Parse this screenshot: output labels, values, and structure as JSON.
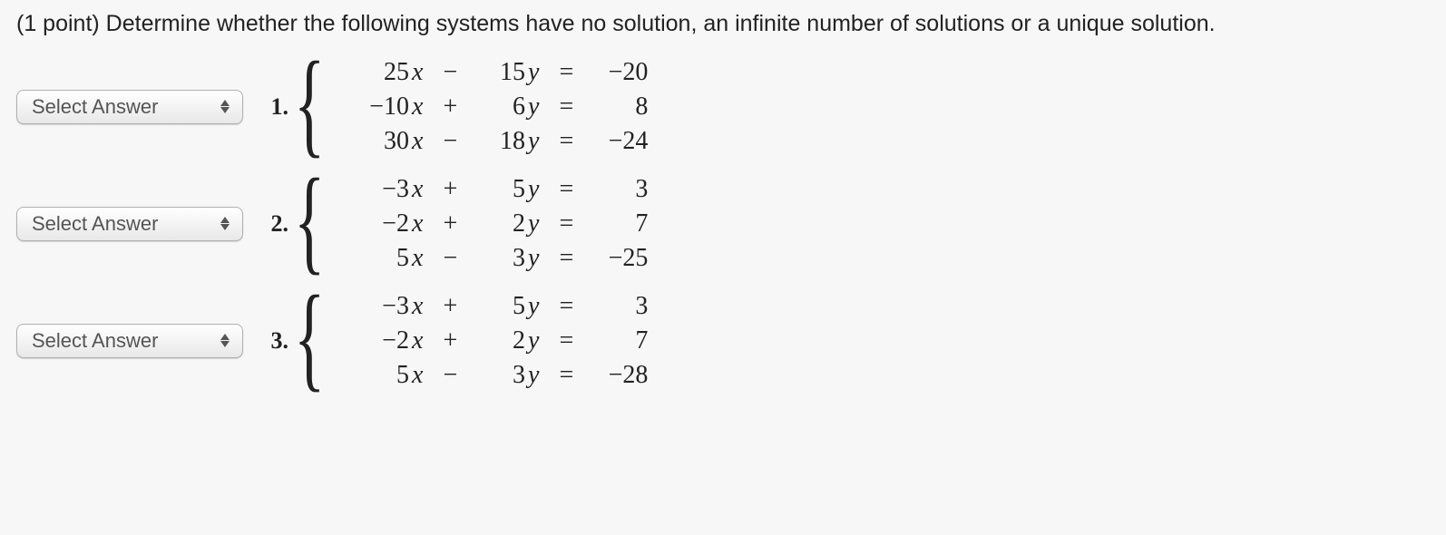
{
  "prompt_prefix": "(1 point) ",
  "prompt_text": "Determine whether the following systems have no solution, an infinite number of solutions or a unique solution.",
  "select_placeholder": "Select Answer",
  "problems": [
    {
      "number": "1.",
      "rows": [
        {
          "c1": "25",
          "v1": "x",
          "op": "−",
          "c2": "15",
          "v2": "y",
          "eq": "=",
          "rhs": "−20"
        },
        {
          "c1": "−10",
          "v1": "x",
          "op": "+",
          "c2": "6",
          "v2": "y",
          "eq": "=",
          "rhs": "8"
        },
        {
          "c1": "30",
          "v1": "x",
          "op": "−",
          "c2": "18",
          "v2": "y",
          "eq": "=",
          "rhs": "−24"
        }
      ]
    },
    {
      "number": "2.",
      "rows": [
        {
          "c1": "−3",
          "v1": "x",
          "op": "+",
          "c2": "5",
          "v2": "y",
          "eq": "=",
          "rhs": "3"
        },
        {
          "c1": "−2",
          "v1": "x",
          "op": "+",
          "c2": "2",
          "v2": "y",
          "eq": "=",
          "rhs": "7"
        },
        {
          "c1": "5",
          "v1": "x",
          "op": "−",
          "c2": "3",
          "v2": "y",
          "eq": "=",
          "rhs": "−25"
        }
      ]
    },
    {
      "number": "3.",
      "rows": [
        {
          "c1": "−3",
          "v1": "x",
          "op": "+",
          "c2": "5",
          "v2": "y",
          "eq": "=",
          "rhs": "3"
        },
        {
          "c1": "−2",
          "v1": "x",
          "op": "+",
          "c2": "2",
          "v2": "y",
          "eq": "=",
          "rhs": "7"
        },
        {
          "c1": "5",
          "v1": "x",
          "op": "−",
          "c2": "3",
          "v2": "y",
          "eq": "=",
          "rhs": "−28"
        }
      ]
    }
  ]
}
